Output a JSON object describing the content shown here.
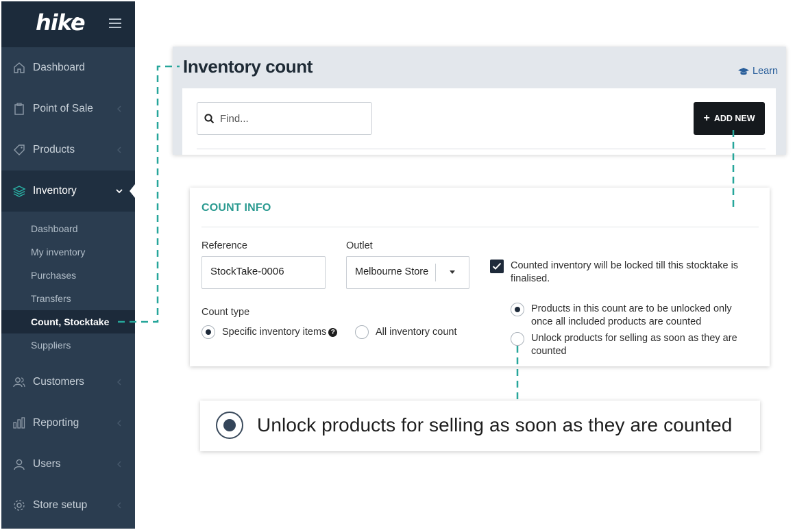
{
  "colors": {
    "sidebar_bg": "#2b3d50",
    "sidebar_brand_bg": "#1c2b3b",
    "accent_teal": "#2a9a90",
    "connector_teal": "#26a69a",
    "button_dark": "#15191d",
    "link_blue": "#2a5f9b"
  },
  "sidebar": {
    "logo_text": "hike",
    "menu_icon": "hamburger-icon",
    "items": [
      {
        "label": "Dashboard",
        "icon": "home-icon",
        "has_chevron": false
      },
      {
        "label": "Point of Sale",
        "icon": "clipboard-icon",
        "has_chevron": true
      },
      {
        "label": "Products",
        "icon": "tag-icon",
        "has_chevron": true
      },
      {
        "label": "Inventory",
        "icon": "layers-icon",
        "has_chevron": true,
        "active": true
      },
      {
        "label": "Customers",
        "icon": "users-icon",
        "has_chevron": true
      },
      {
        "label": "Reporting",
        "icon": "bar-chart-icon",
        "has_chevron": true
      },
      {
        "label": "Users",
        "icon": "user-icon",
        "has_chevron": true
      },
      {
        "label": "Store setup",
        "icon": "gear-icon",
        "has_chevron": true
      }
    ],
    "inventory_subitems": [
      {
        "label": "Dashboard"
      },
      {
        "label": "My inventory"
      },
      {
        "label": "Purchases"
      },
      {
        "label": "Transfers"
      },
      {
        "label": "Count, Stocktake",
        "active": true
      },
      {
        "label": "Suppliers"
      }
    ]
  },
  "header": {
    "title": "Inventory count",
    "learn_label": "Learn",
    "learn_icon": "graduation-cap-icon",
    "search_placeholder": "Find...",
    "search_icon": "search-icon",
    "add_new_label": "ADD NEW",
    "add_new_icon": "plus-icon"
  },
  "count_info": {
    "title": "COUNT INFO",
    "reference_label": "Reference",
    "reference_value": "StockTake-0006",
    "outlet_label": "Outlet",
    "outlet_value": "Melbourne Store",
    "count_type_label": "Count type",
    "count_type_options": [
      {
        "label": "Specific inventory items",
        "selected": true,
        "help_icon": "question-circle-icon"
      },
      {
        "label": "All inventory count",
        "selected": false
      }
    ],
    "lock_checkbox_label": "Counted inventory will be locked till this stocktake is finalised.",
    "lock_checked": true,
    "unlock_options": [
      {
        "label": "Products in this count are to be unlocked only once all included products are counted",
        "selected": true
      },
      {
        "label": "Unlock products for selling as soon as they are counted",
        "selected": false
      }
    ]
  },
  "callout": {
    "text": "Unlock products for selling as soon as they are counted",
    "selected": true
  }
}
